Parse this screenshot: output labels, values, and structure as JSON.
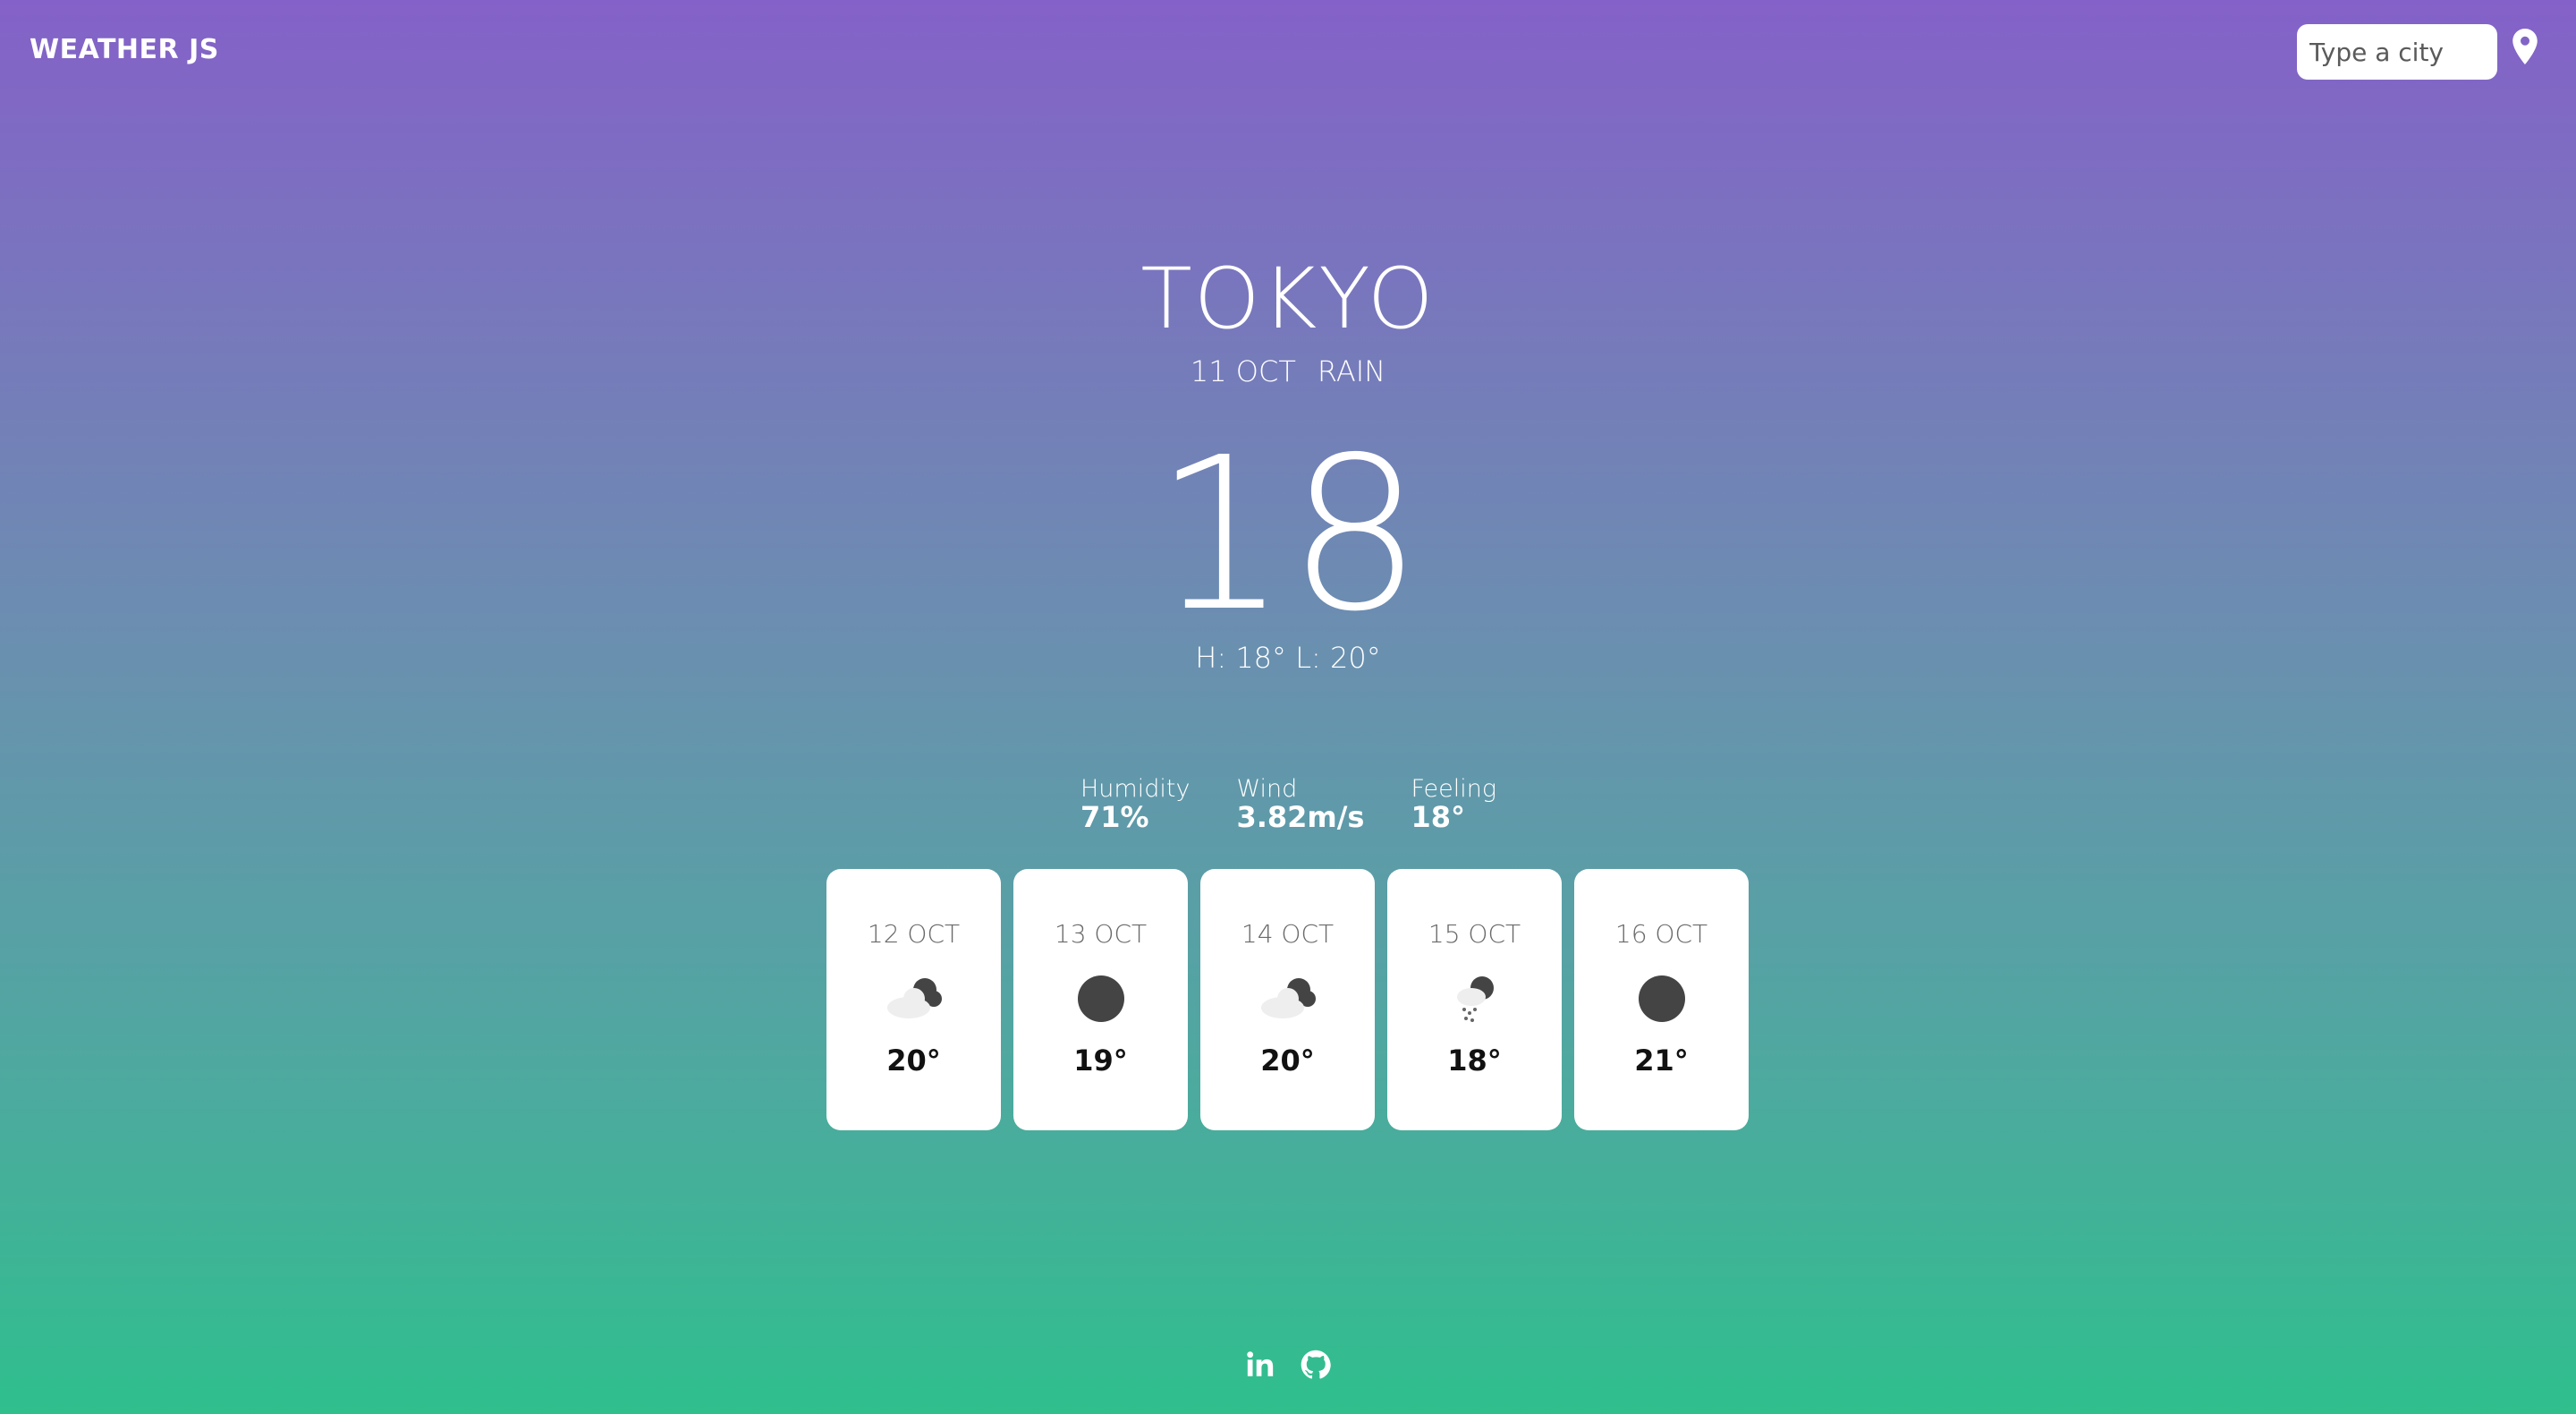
{
  "header": {
    "brand": "WEATHER JS",
    "search_placeholder": "Type a city",
    "location_icon": "location-pin-icon"
  },
  "current": {
    "city": "TOKYO",
    "date": "11 OCT",
    "condition": "RAIN",
    "temp": "18",
    "hilo": "H: 18° L: 20°"
  },
  "stats": [
    {
      "label": "Humidity",
      "value": "71%"
    },
    {
      "label": "Wind",
      "value": "3.82m/s"
    },
    {
      "label": "Feeling",
      "value": "18°"
    }
  ],
  "forecast": [
    {
      "date": "12 OCT",
      "temp": "20°",
      "icon": "cloud-moon-icon"
    },
    {
      "date": "13 OCT",
      "temp": "19°",
      "icon": "moon-icon"
    },
    {
      "date": "14 OCT",
      "temp": "20°",
      "icon": "cloud-moon-icon"
    },
    {
      "date": "15 OCT",
      "temp": "18°",
      "icon": "rain-moon-icon"
    },
    {
      "date": "16 OCT",
      "temp": "21°",
      "icon": "moon-icon"
    }
  ],
  "footer": {
    "links": [
      "linkedin-icon",
      "github-icon"
    ]
  },
  "colors": {
    "gradient_top": "#8461c8",
    "gradient_bottom": "#2fbf8d",
    "card_bg": "#ffffff"
  }
}
